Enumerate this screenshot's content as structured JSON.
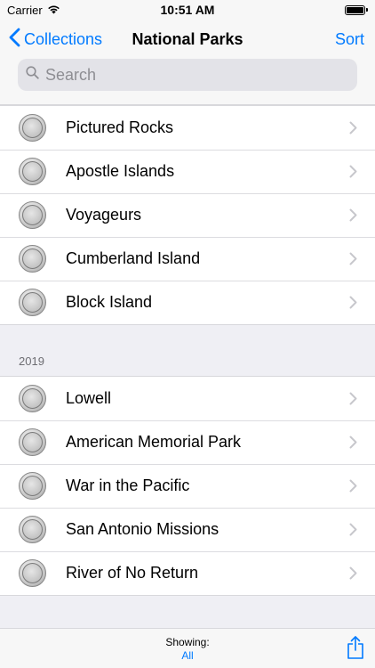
{
  "status_bar": {
    "carrier": "Carrier",
    "time": "10:51 AM",
    "icons": [
      "wifi-icon",
      "battery-icon"
    ]
  },
  "nav": {
    "back_label": "Collections",
    "title": "National Parks",
    "sort_label": "Sort"
  },
  "search": {
    "placeholder": "Search",
    "value": ""
  },
  "sections": [
    {
      "header": "",
      "items": [
        {
          "label": "Pictured Rocks"
        },
        {
          "label": "Apostle Islands"
        },
        {
          "label": "Voyageurs"
        },
        {
          "label": "Cumberland Island"
        },
        {
          "label": "Block Island"
        }
      ]
    },
    {
      "header": "2019",
      "items": [
        {
          "label": "Lowell"
        },
        {
          "label": "American Memorial Park"
        },
        {
          "label": "War in the Pacific"
        },
        {
          "label": "San Antonio Missions"
        },
        {
          "label": "River of No Return"
        }
      ]
    }
  ],
  "toolbar": {
    "showing_label": "Showing:",
    "showing_value": "All",
    "share_icon": "share-icon"
  },
  "colors": {
    "accent": "#007aff",
    "background": "#efeff4",
    "separator": "#d8d8dc"
  }
}
